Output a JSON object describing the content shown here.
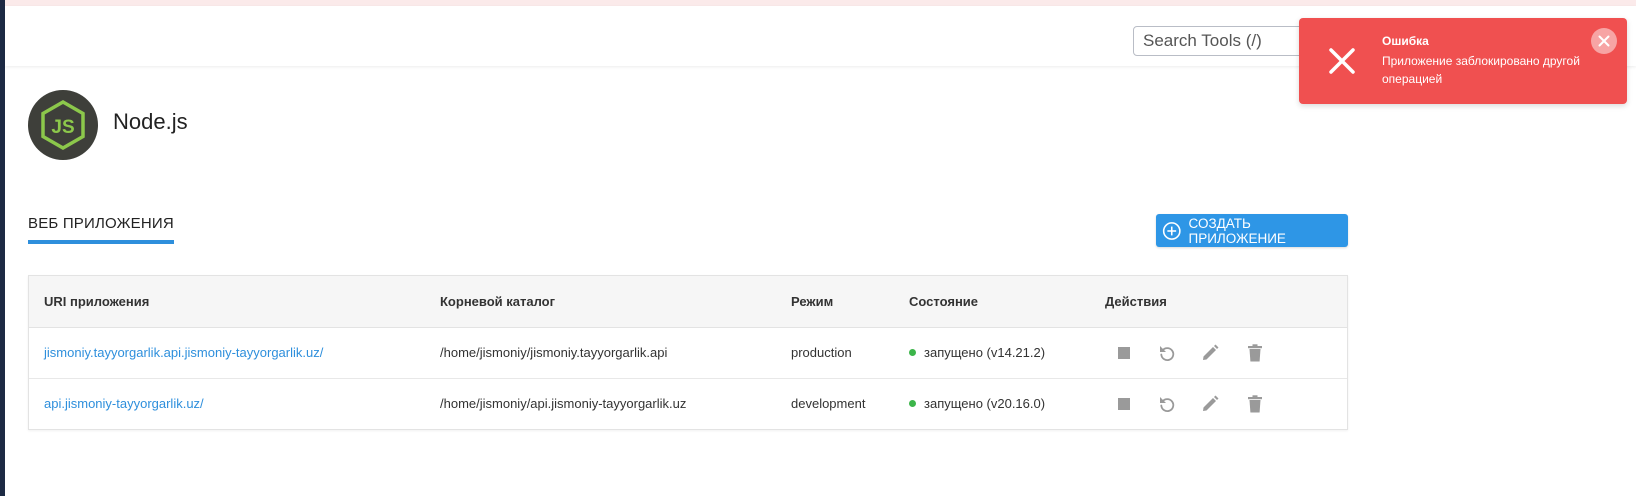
{
  "header": {
    "search_placeholder": "Search Tools (/)"
  },
  "toast": {
    "icon": "close-icon",
    "title": "Ошибка",
    "message": "Приложение заблокировано другой операцией",
    "color": "#f05050"
  },
  "app": {
    "title": "Node.js",
    "logo": "nodejs-logo"
  },
  "tabs": {
    "web_apps": "ВЕБ ПРИЛОЖЕНИЯ"
  },
  "create_button": {
    "label": "СОЗДАТЬ ПРИЛОЖЕНИЕ",
    "icon": "plus-circle-icon",
    "color": "#2e96e6"
  },
  "table": {
    "headers": [
      "URI приложения",
      "Корневой каталог",
      "Режим",
      "Состояние",
      "Действия"
    ],
    "rows": [
      {
        "uri": "jismoniy.tayyorgarlik.api.jismoniy-tayyorgarlik.uz/",
        "root": "/home/jismoniy/jismoniy.tayyorgarlik.api",
        "mode": "production",
        "state": "запущено (v14.21.2)"
      },
      {
        "uri": "api.jismoniy-tayyorgarlik.uz/",
        "root": "/home/jismoniy/api.jismoniy-tayyorgarlik.uz",
        "mode": "development",
        "state": "запущено (v20.16.0)"
      }
    ],
    "action_icons": [
      "stop-icon",
      "restart-icon",
      "edit-icon",
      "delete-icon"
    ]
  },
  "colors": {
    "accent": "#2e8fdc",
    "status_running": "#3cb54a",
    "sidebar": "#1d2a44"
  }
}
